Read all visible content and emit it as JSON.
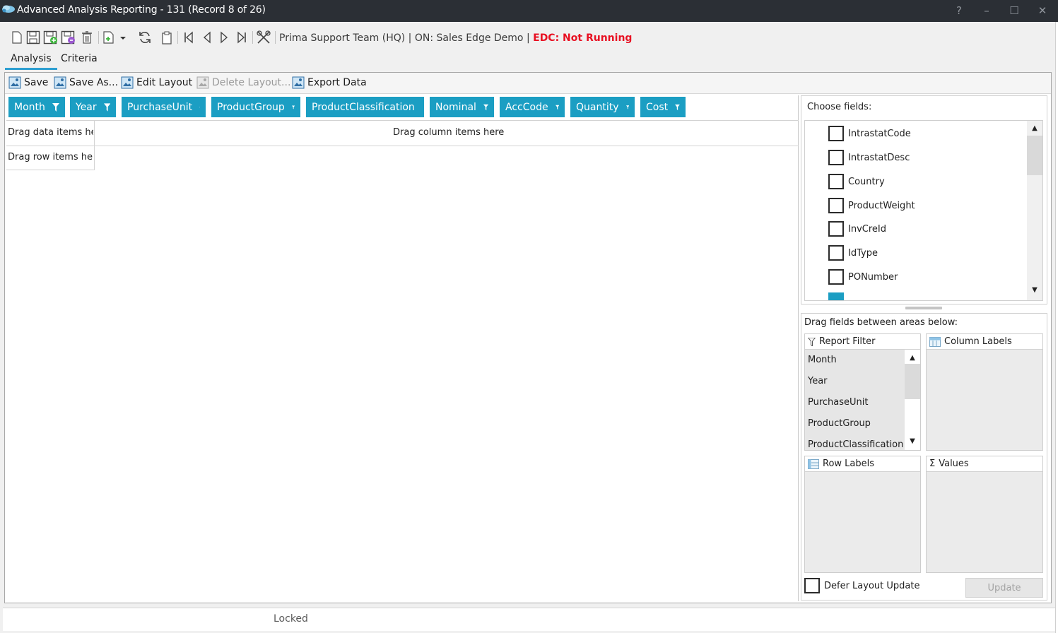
{
  "window": {
    "title": "Advanced Analysis Reporting - 131  (Record 8 of 26)",
    "controls": {
      "help": "?",
      "minimize": "–",
      "maximize": "☐",
      "close": "✕"
    }
  },
  "toolbar": {
    "icons": [
      "new-icon",
      "save-icon",
      "save-new-icon",
      "save-copy-icon",
      "delete-icon",
      "add-dropdown-icon",
      "refresh-icon",
      "clipboard-icon",
      "first-record-icon",
      "previous-record-icon",
      "next-record-icon",
      "last-record-icon",
      "tools-icon"
    ],
    "status_prefix": "Prima Support Team  (HQ) | ON: Sales Edge Demo | ",
    "status_edc": "EDC: Not Running"
  },
  "tabs": [
    {
      "label": "Analysis",
      "active": true
    },
    {
      "label": "Criteria",
      "active": false
    }
  ],
  "actions": {
    "save": "Save",
    "save_as": "Save As...",
    "edit_layout": "Edit Layout",
    "delete_layout": "Delete Layout...",
    "export_data": "Export Data"
  },
  "pivot": {
    "filter_fields": [
      "Month",
      "Year",
      "PurchaseUnit",
      "ProductGroup",
      "ProductClassification",
      "Nominal",
      "AccCode",
      "Quantity",
      "Cost"
    ],
    "drag_data": "Drag data items he",
    "drag_column": "Drag column items here",
    "drag_row": "Drag row items her"
  },
  "field_list": {
    "label": "Choose fields:",
    "items": [
      {
        "label": "IntrastatCode",
        "checked": false
      },
      {
        "label": "IntrastatDesc",
        "checked": false
      },
      {
        "label": "Country",
        "checked": false
      },
      {
        "label": "ProductWeight",
        "checked": false
      },
      {
        "label": "InvCreId",
        "checked": false
      },
      {
        "label": "IdType",
        "checked": false
      },
      {
        "label": "PONumber",
        "checked": false
      }
    ],
    "partial_item_checked": true
  },
  "areas": {
    "label": "Drag fields between areas below:",
    "report_filter": {
      "title": "Report Filter",
      "items": [
        "Month",
        "Year",
        "PurchaseUnit",
        "ProductGroup",
        "ProductClassification"
      ]
    },
    "column_labels": {
      "title": "Column Labels"
    },
    "row_labels": {
      "title": "Row Labels"
    },
    "values": {
      "title": "Values",
      "symbol": "Σ"
    },
    "defer_label": "Defer Layout Update",
    "update_label": "Update"
  },
  "footer": {
    "status": "Locked"
  },
  "colors": {
    "accent": "#1b9ec3",
    "titlebar": "#2b2f35",
    "edc_status": "#e81123",
    "tab_underline": "#2e9fd1"
  }
}
